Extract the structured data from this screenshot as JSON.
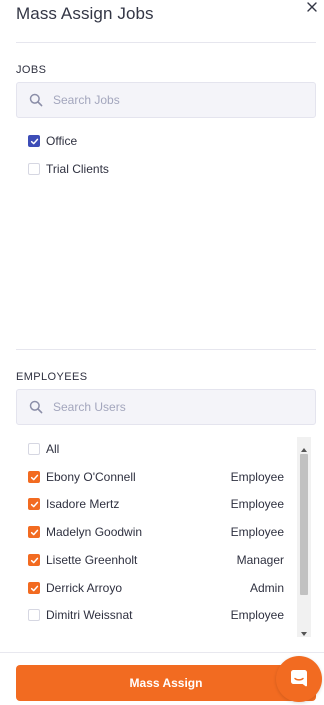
{
  "panel": {
    "title": "Mass Assign Jobs",
    "close_icon": "close-icon"
  },
  "jobs": {
    "label": "JOBS",
    "search_placeholder": "Search Jobs",
    "items": [
      {
        "label": "Office",
        "checked": true
      },
      {
        "label": "Trial Clients",
        "checked": false
      }
    ]
  },
  "employees": {
    "label": "EMPLOYEES",
    "search_placeholder": "Search Users",
    "all_label": "All",
    "all_checked": false,
    "items": [
      {
        "name": "Ebony O'Connell",
        "role": "Employee",
        "checked": true
      },
      {
        "name": "Isadore Mertz",
        "role": "Employee",
        "checked": true
      },
      {
        "name": "Madelyn Goodwin",
        "role": "Employee",
        "checked": true
      },
      {
        "name": "Lisette Greenholt",
        "role": "Manager",
        "checked": true
      },
      {
        "name": "Derrick Arroyo",
        "role": "Admin",
        "checked": true
      },
      {
        "name": "Dimitri Weissnat",
        "role": "Employee",
        "checked": false
      }
    ]
  },
  "actions": {
    "mass_assign_label": "Mass Assign"
  },
  "colors": {
    "accent": "#f26b21",
    "job_check": "#3d4db7"
  },
  "icons": {
    "search": "search-icon",
    "chat": "chat-icon"
  }
}
